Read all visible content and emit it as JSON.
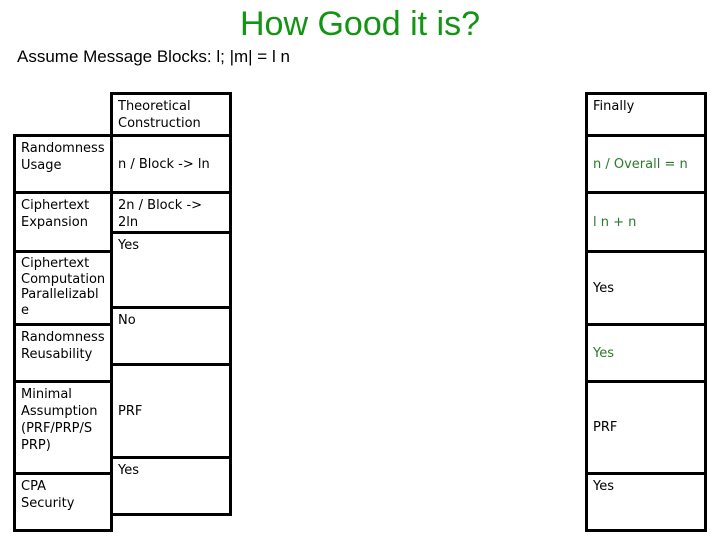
{
  "slide": {
    "title": "How Good it is?",
    "subtitle": "Assume Message Blocks: l;  |m| = l n",
    "colors": {
      "title": "#129512",
      "highlight": "#2a7a2a",
      "text": "#000000"
    }
  },
  "table": {
    "headers": {
      "theoretical": "Theoretical\nConstruction",
      "finally": "Finally"
    },
    "rows": [
      {
        "label": "Randomness\nUsage",
        "theoretical": "n / Block -> ln",
        "finally": "n / Overall = n",
        "finally_highlight": true
      },
      {
        "label": "Ciphertext\nExpansion",
        "theoretical": "2n / Block -> 2ln",
        "finally": "l n + n",
        "finally_highlight": true
      },
      {
        "label": "Ciphertext\nComputation\nParallelizabl\ne",
        "theoretical": "Yes",
        "finally": "Yes",
        "finally_highlight": false
      },
      {
        "label": "Randomness\nReusability",
        "theoretical": "No",
        "finally": "Yes",
        "finally_highlight": true
      },
      {
        "label": "Minimal\nAssumption\n(PRF/PRP/S\nPRP)",
        "theoretical": "PRF",
        "finally": "PRF",
        "finally_highlight": false
      },
      {
        "label": "CPA\nSecurity",
        "theoretical": "Yes",
        "finally": "Yes",
        "finally_highlight": false
      }
    ]
  }
}
